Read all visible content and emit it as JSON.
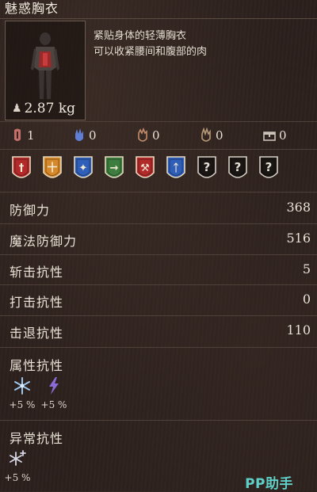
{
  "item": {
    "name": "魅惑胸衣",
    "weight": "2.87 kg",
    "description": [
      "紧贴身体的轻薄胸衣",
      "可以收紧腰间和腹部的肉"
    ]
  },
  "requirements": [
    {
      "icon": "strength-hand-icon",
      "value": "1",
      "color": "#c3706a"
    },
    {
      "icon": "dexterity-hand-icon",
      "value": "0",
      "color": "#5f7fd6"
    },
    {
      "icon": "faith-hand-icon",
      "value": "0",
      "color": "#c28b6a"
    },
    {
      "icon": "intelligence-hand-icon",
      "value": "0",
      "color": "#b69a78"
    },
    {
      "icon": "chest-icon",
      "value": "0",
      "color": "#c9c2b6"
    }
  ],
  "badges": [
    {
      "icon": "sword-badge-icon",
      "color": "#b32a2a",
      "symbol": "†"
    },
    {
      "icon": "crossbow-badge-icon",
      "color": "#d6882a",
      "symbol": "十"
    },
    {
      "icon": "staff-badge-icon",
      "color": "#2f5fb8",
      "symbol": "✦"
    },
    {
      "icon": "arrow-badge-icon",
      "color": "#3d7d3f",
      "symbol": "→"
    },
    {
      "icon": "axe-badge-icon",
      "color": "#b32a2a",
      "symbol": "⚒"
    },
    {
      "icon": "rune-badge-icon",
      "color": "#2f5fb8",
      "symbol": "ᛏ"
    },
    {
      "icon": "unknown-badge-icon",
      "color": "#1a1614",
      "symbol": "?"
    },
    {
      "icon": "unknown-badge-icon",
      "color": "#1a1614",
      "symbol": "?"
    },
    {
      "icon": "unknown-badge-icon",
      "color": "#1a1614",
      "symbol": "?"
    }
  ],
  "stats": [
    {
      "label": "防御力",
      "value": "368"
    },
    {
      "label": "魔法防御力",
      "value": "516"
    },
    {
      "label": "斩击抗性",
      "value": "5"
    },
    {
      "label": "打击抗性",
      "value": "0"
    },
    {
      "label": "击退抗性",
      "value": "110"
    }
  ],
  "attribute_resistance": {
    "label": "属性抗性",
    "items": [
      {
        "icon": "frost-icon",
        "value": "+5 %"
      },
      {
        "icon": "lightning-icon",
        "value": "+5 %"
      }
    ]
  },
  "status_resistance": {
    "label": "异常抗性",
    "items": [
      {
        "icon": "frostbite-icon",
        "value": "+5 %"
      }
    ]
  },
  "watermark": "PP助手"
}
